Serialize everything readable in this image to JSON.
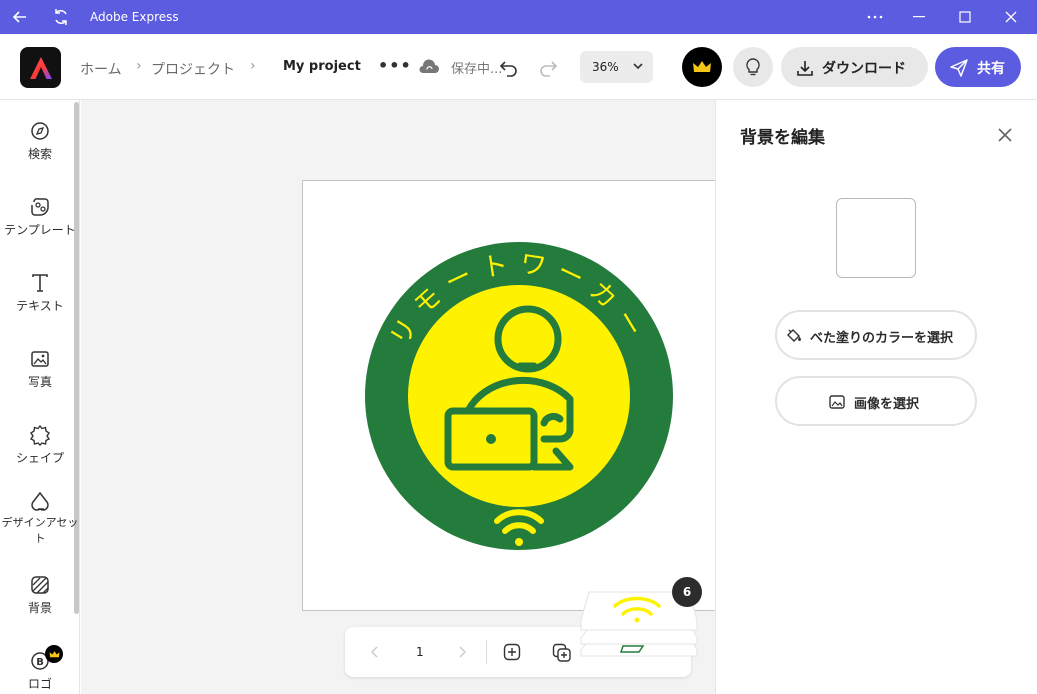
{
  "titlebar": {
    "app_title": "Adobe Express"
  },
  "header": {
    "breadcrumb_home": "ホーム",
    "breadcrumb_projects": "プロジェクト",
    "project_name": "My project",
    "more": "•••",
    "saving_status": "保存中...",
    "zoom": "36%",
    "download_label": "ダウンロード",
    "share_label": "共有"
  },
  "rail": {
    "items": [
      {
        "label": "検索",
        "icon": "compass-icon"
      },
      {
        "label": "テンプレート",
        "icon": "template-icon"
      },
      {
        "label": "テキスト",
        "icon": "text-icon"
      },
      {
        "label": "写真",
        "icon": "photo-icon"
      },
      {
        "label": "シェイプ",
        "icon": "shape-icon"
      },
      {
        "label": "デザインアセット",
        "icon": "design-asset-icon"
      },
      {
        "label": "背景",
        "icon": "background-icon"
      },
      {
        "label": "ロゴ",
        "icon": "logo-icon"
      }
    ]
  },
  "canvas": {
    "arc_text": "リモートワーカー",
    "page_number": "1",
    "page_count_badge": "6",
    "colors": {
      "outer_ring": "#237b3c",
      "inner_fill": "#fff200",
      "accent": "#5c5ce0"
    }
  },
  "panel": {
    "title": "背景を編集",
    "fill_color_label": "べた塗りのカラーを選択",
    "select_image_label": "画像を選択"
  }
}
